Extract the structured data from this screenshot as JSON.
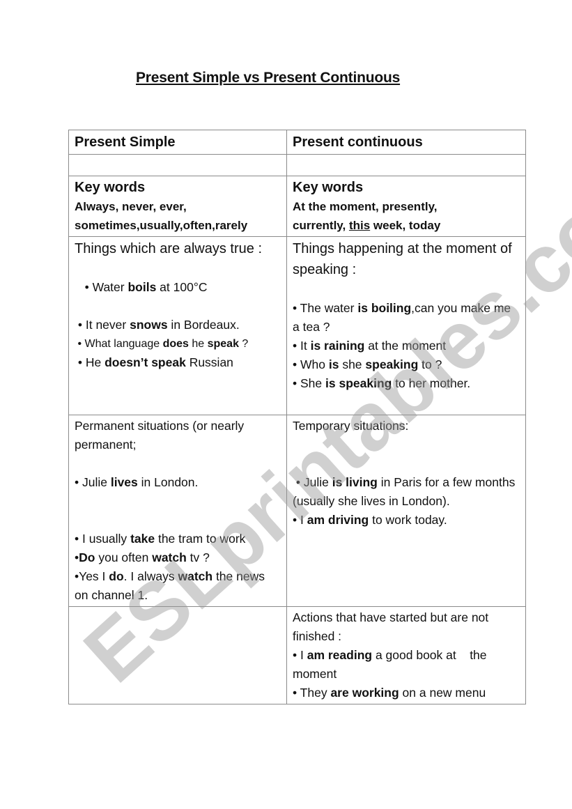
{
  "title": "Present Simple vs Present Continuous",
  "watermark": "ESLprintables.com",
  "table": {
    "headers": [
      "Present Simple",
      "Present continuous"
    ],
    "key_words": {
      "left": {
        "title": "Key words",
        "lines": [
          [
            {
              "t": "Always, never, ever,"
            }
          ],
          [
            {
              "t": "sometimes,usually,often,rarely"
            }
          ]
        ]
      },
      "right": {
        "title": "Key words",
        "lines": [
          [
            {
              "t": "At the moment, presently,"
            }
          ],
          [
            {
              "t": "currently, "
            },
            {
              "t": "this",
              "u": true
            },
            {
              "t": " week, today"
            }
          ]
        ]
      }
    },
    "rows": [
      {
        "left": {
          "heading": "Things which are always true :",
          "lines": [
            {
              "gap": true
            },
            {
              "segs": [
                {
                  "t": "   • Water "
                },
                {
                  "t": "boils",
                  "b": true
                },
                {
                  "t": " at 100°C"
                }
              ]
            },
            {
              "gap": true
            },
            {
              "segs": [
                {
                  "t": " • It never "
                },
                {
                  "t": "snows",
                  "b": true
                },
                {
                  "t": " in Bordeaux."
                }
              ]
            },
            {
              "small": true,
              "segs": [
                {
                  "t": " • What language "
                },
                {
                  "t": "does",
                  "b": true
                },
                {
                  "t": " he "
                },
                {
                  "t": "speak",
                  "b": true
                },
                {
                  "t": " ?"
                }
              ]
            },
            {
              "segs": [
                {
                  "t": " • He "
                },
                {
                  "t": "doesn’t speak",
                  "b": true
                },
                {
                  "t": " Russian"
                }
              ]
            }
          ]
        },
        "right": {
          "heading": "Things happening at the moment of speaking :",
          "lines": [
            {
              "gap": true
            },
            {
              "segs": [
                {
                  "t": "• The water "
                },
                {
                  "t": "is boiling",
                  "b": true
                },
                {
                  "t": ",can you make me a tea ?"
                }
              ]
            },
            {
              "segs": [
                {
                  "t": "• It "
                },
                {
                  "t": "is raining",
                  "b": true
                },
                {
                  "t": " at the moment"
                }
              ]
            },
            {
              "segs": [
                {
                  "t": "• Who "
                },
                {
                  "t": "is",
                  "b": true
                },
                {
                  "t": " she "
                },
                {
                  "t": "speaking",
                  "b": true
                },
                {
                  "t": " to ?"
                }
              ]
            },
            {
              "segs": [
                {
                  "t": "• She "
                },
                {
                  "t": "is speaking",
                  "b": true
                },
                {
                  "t": " to her mother."
                }
              ]
            }
          ]
        }
      },
      {
        "left": {
          "lines": [
            {
              "segs": [
                {
                  "t": "Permanent situations (or nearly permanent;"
                }
              ]
            },
            {
              "gap": true
            },
            {
              "segs": [
                {
                  "t": "• Julie "
                },
                {
                  "t": "lives",
                  "b": true
                },
                {
                  "t": " in London."
                }
              ]
            },
            {
              "gap": true
            },
            {
              "gap": true
            },
            {
              "segs": [
                {
                  "t": "• I usually "
                },
                {
                  "t": "take",
                  "b": true
                },
                {
                  "t": " the tram to work"
                }
              ]
            },
            {
              "segs": [
                {
                  "t": "•"
                },
                {
                  "t": "Do",
                  "b": true
                },
                {
                  "t": " you often "
                },
                {
                  "t": "watch",
                  "b": true
                },
                {
                  "t": " tv ?"
                }
              ]
            },
            {
              "segs": [
                {
                  "t": "•Yes I "
                },
                {
                  "t": "do",
                  "b": true
                },
                {
                  "t": ". I always "
                },
                {
                  "t": "watch",
                  "b": true
                },
                {
                  "t": " the news on channel 1."
                }
              ]
            }
          ]
        },
        "right": {
          "lines": [
            {
              "segs": [
                {
                  "t": "Temporary situations:"
                }
              ]
            },
            {
              "gap": true
            },
            {
              "gap": true
            },
            {
              "segs": [
                {
                  "t": " • Julie "
                },
                {
                  "t": "is living",
                  "b": true
                },
                {
                  "t": " in Paris for a few months (usually she lives in London)."
                }
              ]
            },
            {
              "segs": [
                {
                  "t": "• I "
                },
                {
                  "t": "am driving",
                  "b": true
                },
                {
                  "t": " to work today."
                }
              ]
            }
          ]
        }
      },
      {
        "left": {
          "lines": []
        },
        "right": {
          "lines": [
            {
              "segs": [
                {
                  "t": "Actions that have started but are not finished :"
                }
              ]
            },
            {
              "segs": [
                {
                  "t": "• I "
                },
                {
                  "t": "am reading",
                  "b": true
                },
                {
                  "t": " a good book at    the moment"
                }
              ]
            },
            {
              "segs": [
                {
                  "t": "• They "
                },
                {
                  "t": "are working",
                  "b": true
                },
                {
                  "t": " on a new menu"
                }
              ]
            }
          ]
        }
      }
    ]
  }
}
